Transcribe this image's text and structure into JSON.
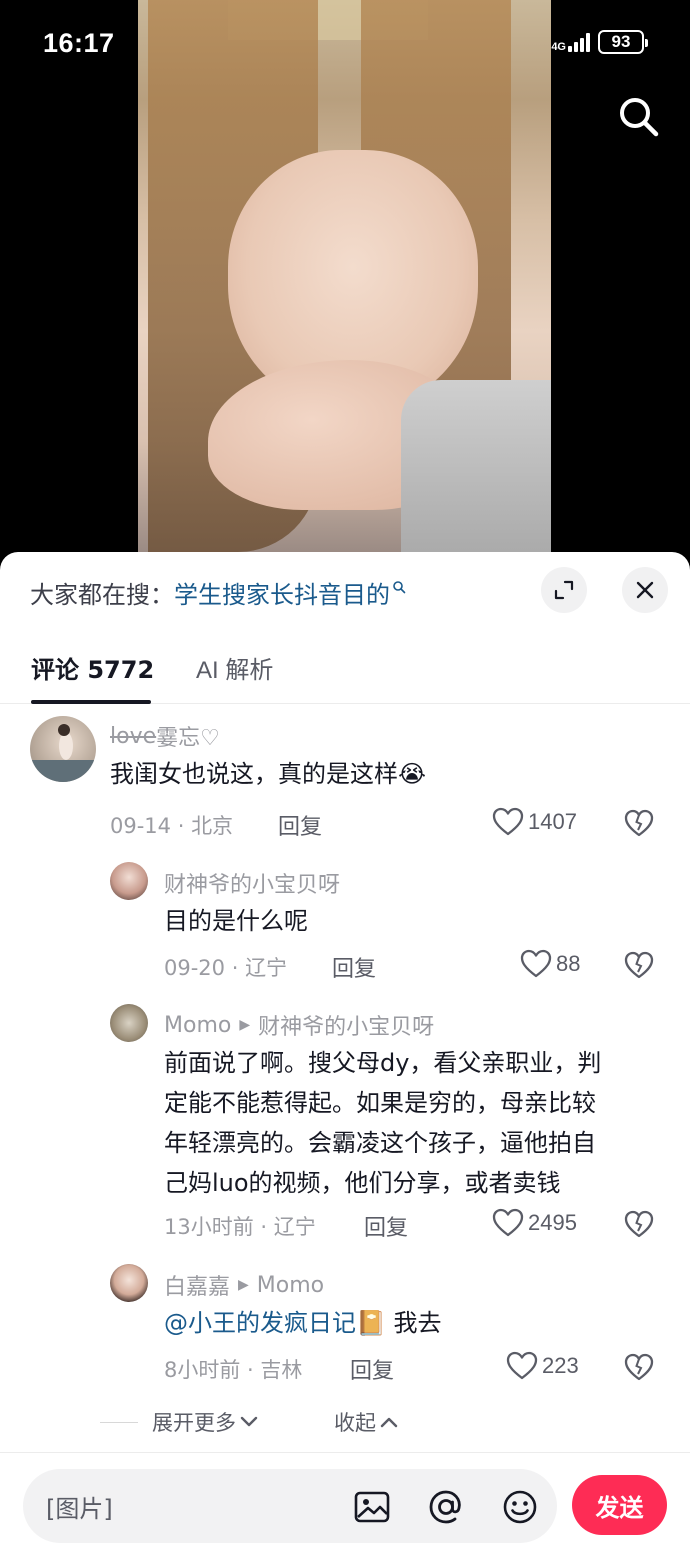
{
  "status_bar": {
    "time": "16:17",
    "network": "4G",
    "battery": "93"
  },
  "video": {
    "search_icon": "search-icon"
  },
  "sheet": {
    "hot_search_prefix": "大家都在搜：",
    "hot_search_term": "学生搜家长抖音目的",
    "expand_icon": "expand-icon",
    "close_icon": "close-icon",
    "tabs": [
      {
        "label": "评论 5772",
        "active": true
      },
      {
        "label": "AI 解析",
        "active": false
      }
    ]
  },
  "comments": [
    {
      "user": "love 霎忘♡",
      "user_struck": "love",
      "user_rest": " 霎忘♡",
      "text": "我闺女也说这，真的是这样",
      "emoji": "😭",
      "date": "09-14",
      "location": "北京",
      "reply_label": "回复",
      "likes": "1407"
    },
    {
      "user": "财神爷的小宝贝呀",
      "text": "目的是什么呢",
      "date": "09-20",
      "location": "辽宁",
      "reply_label": "回复",
      "likes": "88"
    },
    {
      "user": "Momo",
      "reply_to": "财神爷的小宝贝呀",
      "text_lines": [
        "前面说了啊。搜父母dy，看父亲职业，判",
        "定能不能惹得起。如果是穷的，母亲比较",
        "年轻漂亮的。会霸凌这个孩子，逼他拍自",
        "己妈luo的视频，他们分享，或者卖钱"
      ],
      "date": "13小时前",
      "location": "辽宁",
      "reply_label": "回复",
      "likes": "2495"
    },
    {
      "user": "白嘉嘉",
      "reply_to": "Momo",
      "mention": "@小王的发疯日记",
      "emoji": "📔",
      "text": "我去",
      "date": "8小时前",
      "location": "吉林",
      "reply_label": "回复",
      "likes": "223"
    }
  ],
  "more": {
    "expand_label": "展开更多",
    "collapse_label": "收起"
  },
  "input": {
    "placeholder": "[图片]",
    "image_icon": "image-icon",
    "at_icon": "at-icon",
    "emoji_icon": "emoji-icon",
    "send_label": "发送"
  },
  "colors": {
    "send": "#fe2c55",
    "link": "#1a5a8c",
    "meta": "#9a9ba1"
  }
}
